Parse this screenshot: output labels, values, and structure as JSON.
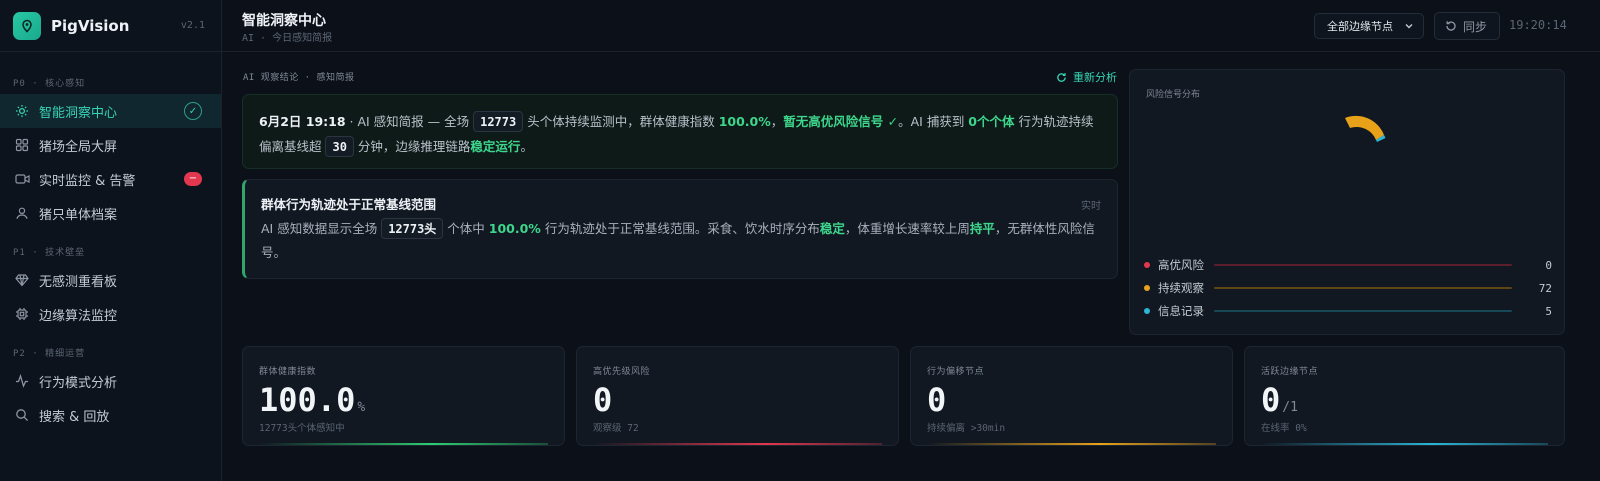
{
  "brand": {
    "name": "PigVision",
    "version": "v2.1"
  },
  "sidebar": {
    "sections": [
      {
        "label": "P0 · 核心感知"
      },
      {
        "label": "P1 · 技术壁垒"
      },
      {
        "label": "P2 · 精细运营"
      }
    ],
    "items": [
      {
        "label": "智能洞察中心",
        "icon": "sun-icon",
        "active": true,
        "badge": "✓"
      },
      {
        "label": "猪场全局大屏",
        "icon": "grid-icon"
      },
      {
        "label": "实时监控 & 告警",
        "icon": "video-icon",
        "badge": "−"
      },
      {
        "label": "猪只单体档案",
        "icon": "user-icon"
      },
      {
        "label": "无感测重看板",
        "icon": "diamond-icon"
      },
      {
        "label": "边缘算法监控",
        "icon": "chip-icon"
      },
      {
        "label": "行为模式分析",
        "icon": "activity-icon"
      },
      {
        "label": "搜索 & 回放",
        "icon": "search-icon"
      }
    ]
  },
  "header": {
    "title": "智能洞察中心",
    "subtitle": "AI · 今日感知简报",
    "node_select": "全部边缘节点",
    "sync_label": "同步",
    "time": "19:20:14"
  },
  "insight": {
    "section_label": "AI 观察结论 · 感知简报",
    "reanalyze_label": "重新分析",
    "brief": {
      "date": "6月2日 19:18",
      "t1": " · AI 感知简报 — 全场 ",
      "count": "12773",
      "t2": " 头个体持续监测中，群体健康指数 ",
      "health": "100.0%",
      "t3": "，",
      "no_risk": "暂无高优风险信号 ✓",
      "t4": "。AI 捕获到 ",
      "captured": "0个个体",
      "t5": " 行为轨迹持续偏离基线超 ",
      "minutes": "30",
      "t6": " 分钟，边缘推理链路",
      "stable": "稳定运行",
      "t7": "。"
    },
    "alert": {
      "title": "群体行为轨迹处于正常基线范围",
      "tag": "实时",
      "b1": "AI 感知数据显示全场 ",
      "count": "12773头",
      "b2": " 个体中 ",
      "pct": "100.0%",
      "b3": " 行为轨迹处于正常基线范围。采食、饮水时序分布",
      "stable": "稳定",
      "b4": "，体重增长速率较上周",
      "flat": "持平",
      "b5": "，无群体性风险信号。"
    }
  },
  "risk": {
    "title": "风险信号分布",
    "items": [
      {
        "label": "高优风险",
        "value": "0",
        "color": "#e2374e"
      },
      {
        "label": "持续观察",
        "value": "72",
        "color": "#e8a21a"
      },
      {
        "label": "信息记录",
        "value": "5",
        "color": "#2bb5d6"
      }
    ]
  },
  "kpis": [
    {
      "label": "群体健康指数",
      "value": "100.0",
      "unit": "%",
      "sub": "12773头个体感知中",
      "color": "#2ecc71"
    },
    {
      "label": "高优先级风险",
      "value": "0",
      "unit": "",
      "sub": "观察级 72",
      "color": "#e2374e"
    },
    {
      "label": "行为偏移节点",
      "value": "0",
      "unit": "",
      "sub": "持续偏离 >30min",
      "color": "#e8a21a"
    },
    {
      "label": "活跃边缘节点",
      "value": "0",
      "unit": "/1",
      "sub": "在线率 0%",
      "color": "#2bb5d6"
    }
  ]
}
